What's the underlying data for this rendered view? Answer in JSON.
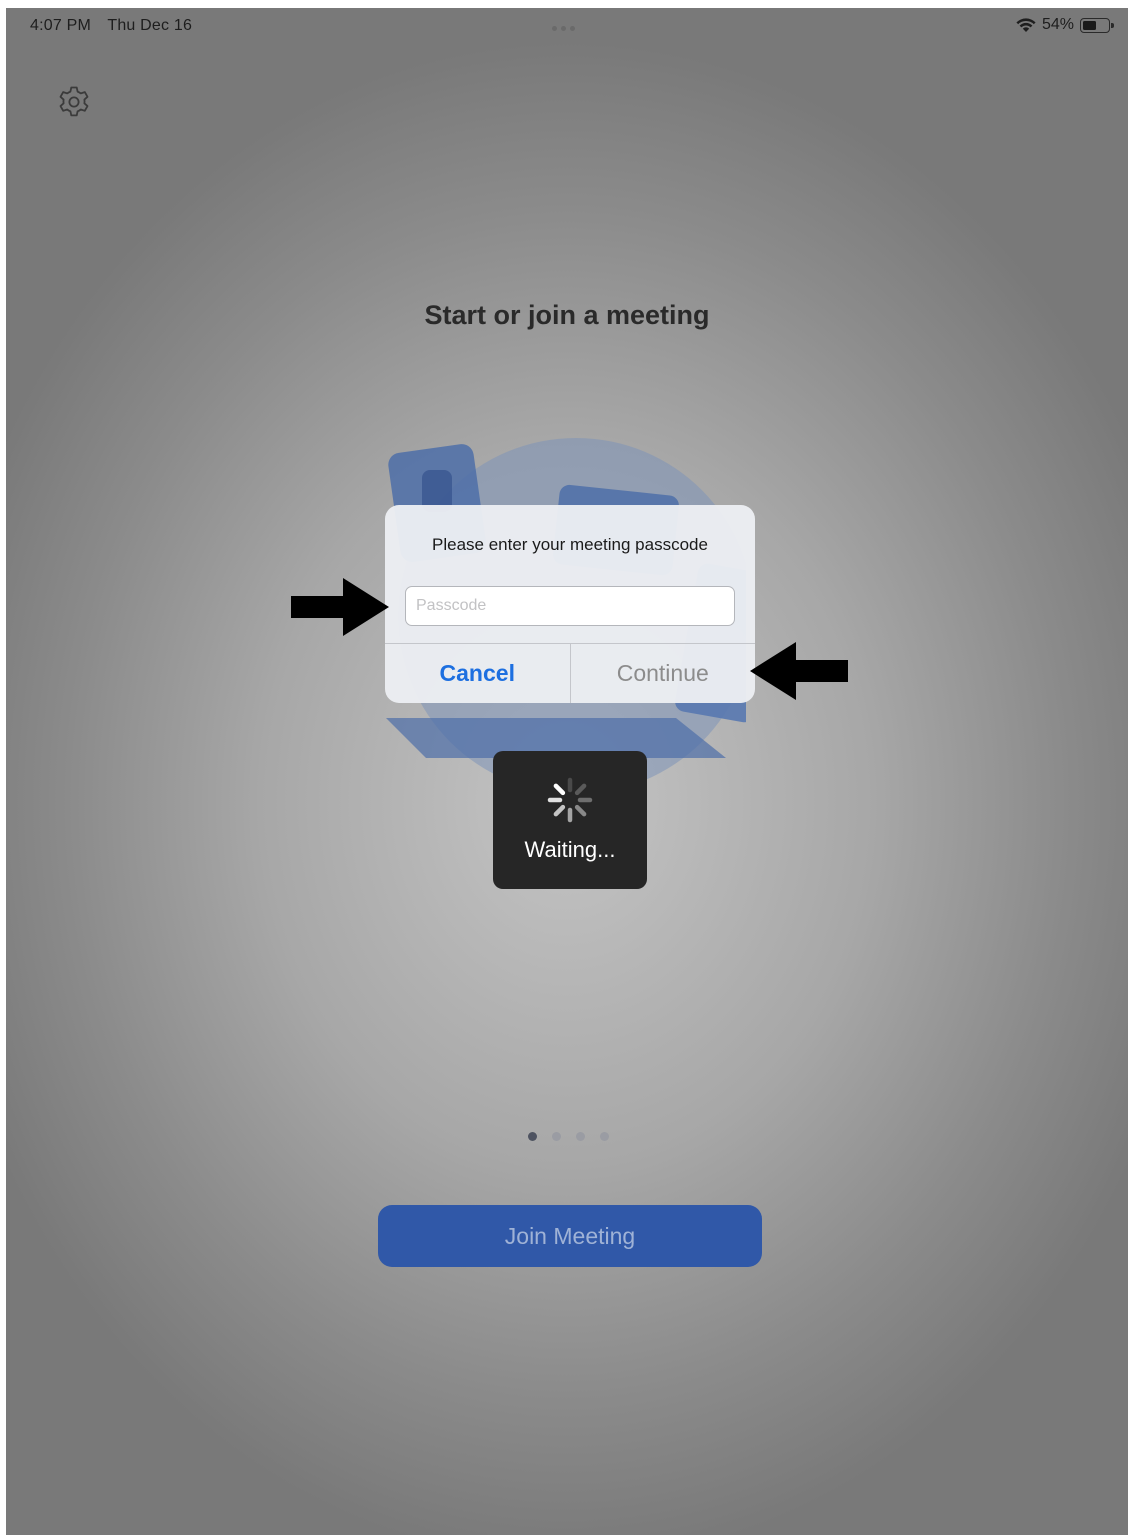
{
  "status_bar": {
    "time": "4:07 PM",
    "date": "Thu Dec 16",
    "battery_percent": "54%",
    "battery_level": 0.54,
    "wifi_icon": "wifi-icon",
    "battery_icon": "battery-icon"
  },
  "settings_icon": "gear-icon",
  "main": {
    "title": "Start or join a meeting",
    "pager": {
      "total": 4,
      "active_index": 0
    },
    "join_label": "Join Meeting"
  },
  "dialog": {
    "message": "Please enter your meeting passcode",
    "input_placeholder": "Passcode",
    "input_value": "",
    "cancel_label": "Cancel",
    "continue_label": "Continue"
  },
  "hud": {
    "text": "Waiting..."
  },
  "colors": {
    "accent_blue": "#1d6fe0",
    "join_button": "#3058a8",
    "hud_background": "#262626"
  }
}
